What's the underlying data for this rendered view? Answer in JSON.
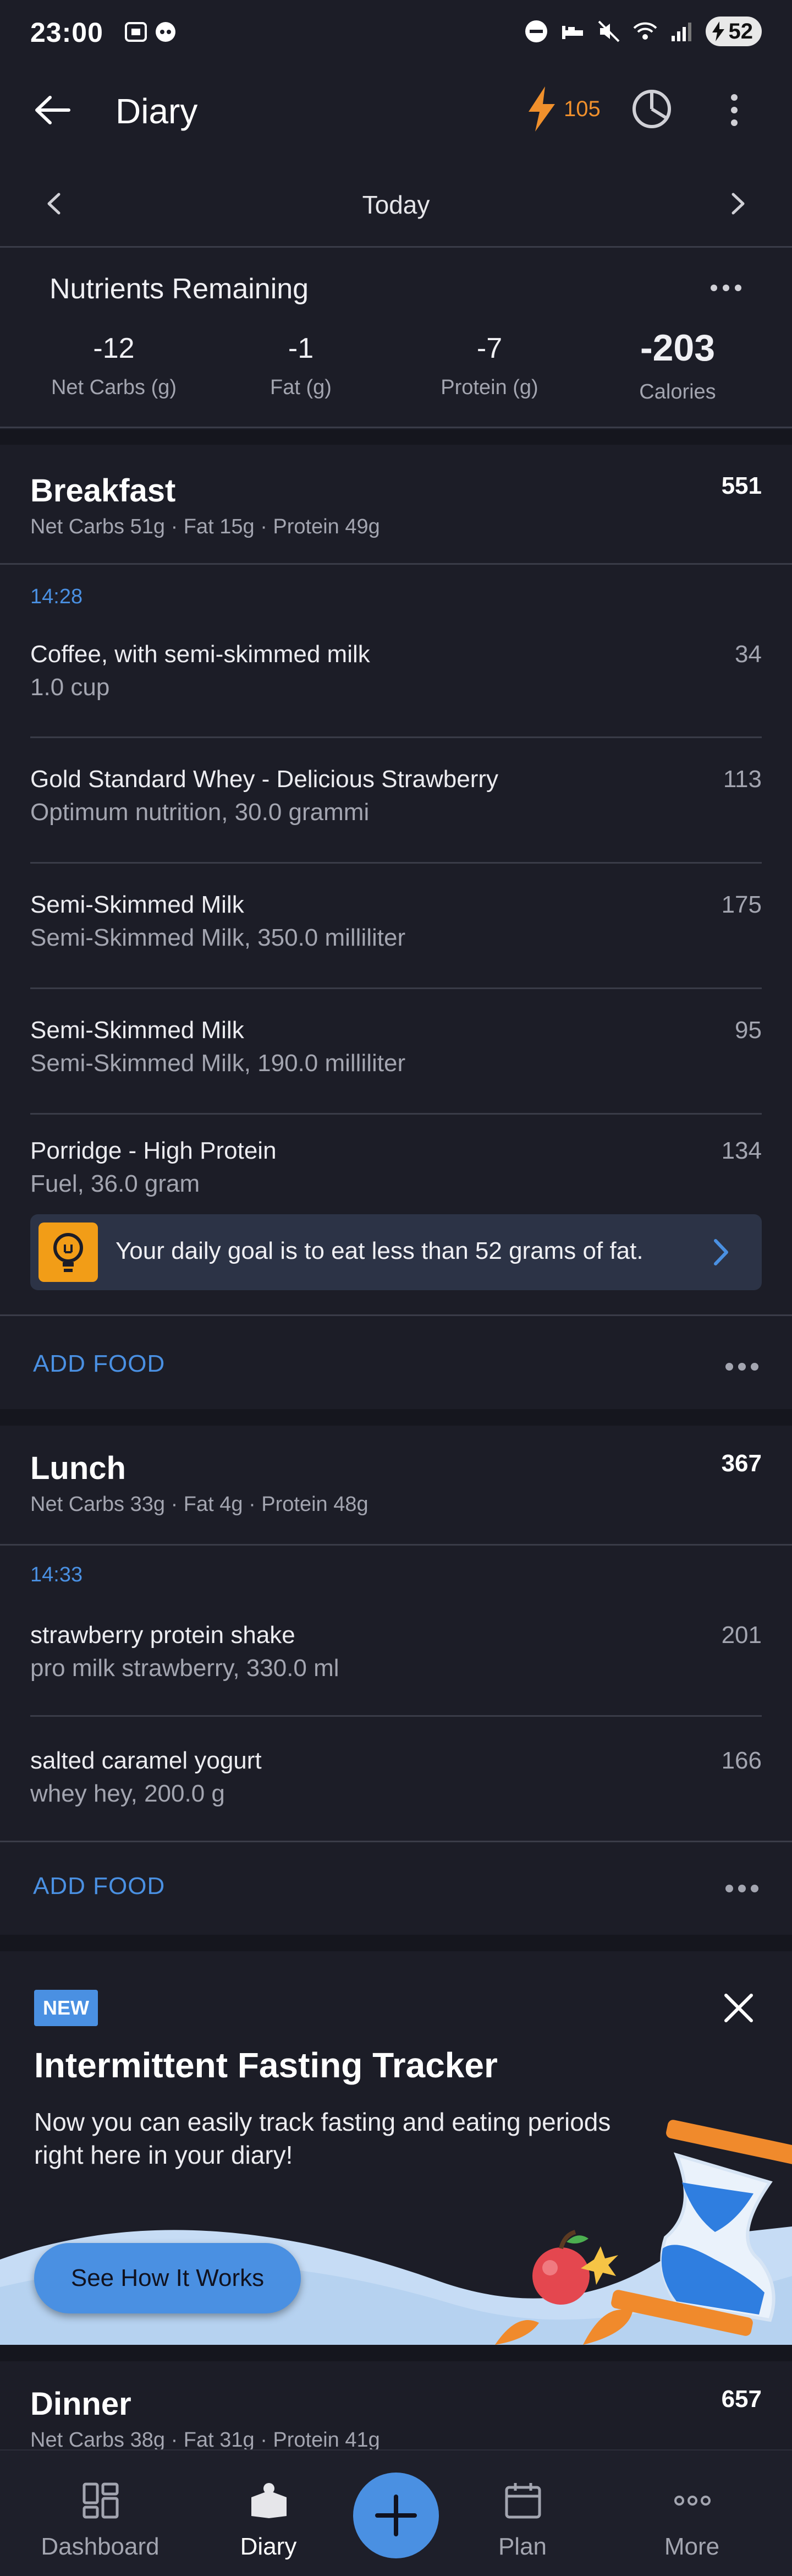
{
  "status_bar": {
    "time": "23:00",
    "battery": "52"
  },
  "app_bar": {
    "title": "Diary",
    "streak_count": "105"
  },
  "date_nav": {
    "label": "Today"
  },
  "nutrients": {
    "title": "Nutrients Remaining",
    "items": [
      {
        "value": "-12",
        "label": "Net Carbs (g)"
      },
      {
        "value": "-1",
        "label": "Fat (g)"
      },
      {
        "value": "-7",
        "label": "Protein (g)"
      },
      {
        "value": "-203",
        "label": "Calories"
      }
    ]
  },
  "breakfast": {
    "name": "Breakfast",
    "calories": "551",
    "macros": "Net Carbs 51g · Fat 15g · Protein 49g",
    "time": "14:28",
    "items": [
      {
        "name": "Coffee, with semi-skimmed milk",
        "detail": "1.0 cup",
        "calories": "34"
      },
      {
        "name": "Gold Standard Whey - Delicious Strawberry",
        "detail": "Optimum nutrition, 30.0 grammi",
        "calories": "113"
      },
      {
        "name": "Semi-Skimmed Milk",
        "detail": "Semi-Skimmed Milk, 350.0 milliliter",
        "calories": "175"
      },
      {
        "name": "Semi-Skimmed Milk",
        "detail": "Semi-Skimmed Milk, 190.0 milliliter",
        "calories": "95"
      },
      {
        "name": "Porridge - High Protein",
        "detail": "Fuel, 36.0 gram",
        "calories": "134"
      }
    ],
    "tip": "Your daily goal is to eat less than 52 grams of fat.",
    "add_food": "ADD FOOD"
  },
  "lunch": {
    "name": "Lunch",
    "calories": "367",
    "macros": "Net Carbs 33g · Fat 4g · Protein 48g",
    "time": "14:33",
    "items": [
      {
        "name": "strawberry protein shake",
        "detail": "pro milk strawberry, 330.0 ml",
        "calories": "201"
      },
      {
        "name": "salted caramel yogurt",
        "detail": "whey hey, 200.0 g",
        "calories": "166"
      }
    ],
    "add_food": "ADD FOOD"
  },
  "promo": {
    "badge": "NEW",
    "title": "Intermittent Fasting Tracker",
    "body": "Now you can easily track fasting and eating periods right here in your diary!",
    "button": "See How It Works"
  },
  "dinner": {
    "name": "Dinner",
    "calories": "657",
    "macros": "Net Carbs 38g · Fat 31g · Protein 41g"
  },
  "bottom_nav": {
    "items": [
      {
        "label": "Dashboard",
        "icon": "dashboard-icon"
      },
      {
        "label": "Diary",
        "icon": "diary-icon"
      },
      {
        "label": "Plan",
        "icon": "calendar-icon"
      },
      {
        "label": "More",
        "icon": "more-dots-icon"
      }
    ]
  },
  "colors": {
    "accent": "#4a90e2",
    "streak": "#f0902c",
    "background": "#1c1d27",
    "tip_icon": "#f29d17"
  }
}
